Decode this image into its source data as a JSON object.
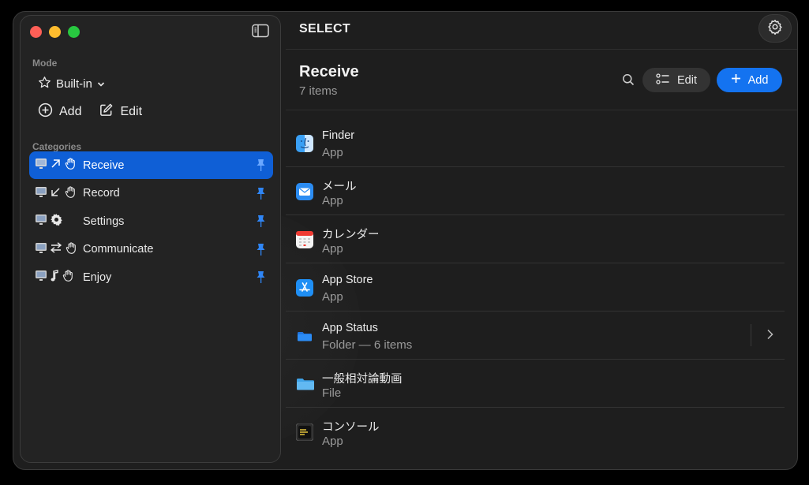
{
  "header": {
    "title": "SELECT"
  },
  "sidebar": {
    "mode_label": "Mode",
    "mode_value": "Built-in",
    "add_label": "Add",
    "edit_label": "Edit",
    "categories_label": "Categories",
    "categories": [
      {
        "label": "Receive",
        "icon": "arrow-up-right-icon",
        "active": true
      },
      {
        "label": "Record",
        "icon": "arrow-down-left-icon",
        "active": false
      },
      {
        "label": "Settings",
        "icon": "gear-icon",
        "active": false
      },
      {
        "label": "Communicate",
        "icon": "arrows-exchange-icon",
        "active": false
      },
      {
        "label": "Enjoy",
        "icon": "music-note-icon",
        "active": false
      }
    ]
  },
  "main": {
    "title": "Receive",
    "count": "7 items",
    "edit_label": "Edit",
    "add_label": "Add",
    "items": [
      {
        "name": "Finder",
        "kind": "App",
        "icon": "finder-icon"
      },
      {
        "name": "メール",
        "kind": "App",
        "icon": "mail-icon"
      },
      {
        "name": "カレンダー",
        "kind": "App",
        "icon": "calendar-icon"
      },
      {
        "name": "App Store",
        "kind": "App",
        "icon": "app-store-icon"
      },
      {
        "name": "App Status",
        "kind": "Folder — 6 items",
        "icon": "folder-icon"
      },
      {
        "name": "一般相対論動画",
        "kind": "File",
        "icon": "folder-light-icon"
      },
      {
        "name": "コンソール",
        "kind": "App",
        "icon": "console-icon"
      }
    ]
  },
  "colors": {
    "accent": "#1473f0",
    "active_row": "#0f5fd6",
    "pin": "#2f86f6"
  }
}
